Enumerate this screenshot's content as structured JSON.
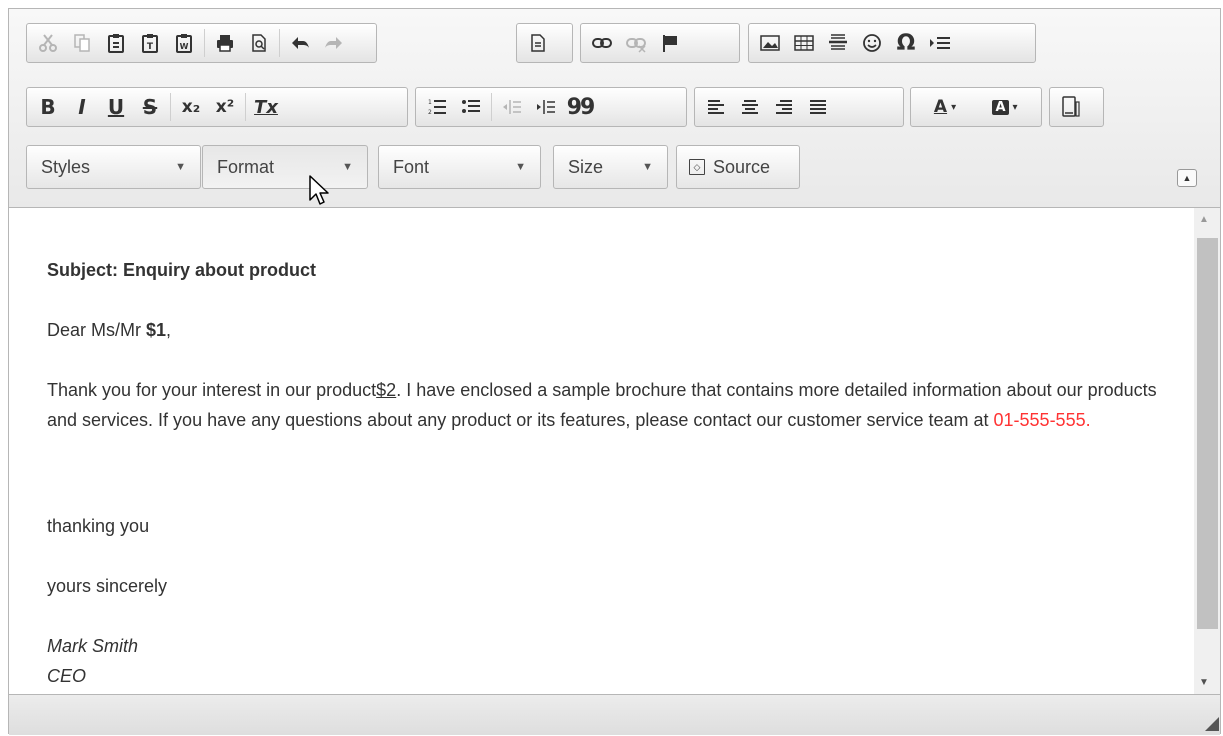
{
  "toolbar": {
    "row1": [
      "cut",
      "copy",
      "paste",
      "paste-text",
      "paste-word",
      "print",
      "preview",
      "undo",
      "redo",
      "templates",
      "link",
      "unlink",
      "anchor",
      "image",
      "table",
      "horizontal-line",
      "smiley",
      "special-char",
      "show-blocks"
    ],
    "omega": "Ω",
    "bold": "B",
    "italic": "I",
    "underline": "U",
    "strike": "S",
    "subscript": "x₂",
    "superscript": "x²",
    "remove_format": "Tx",
    "blockquote": "99",
    "text_color": "A",
    "bg_color": "A",
    "styles_label": "Styles",
    "format_label": "Format",
    "font_label": "Font",
    "size_label": "Size",
    "source_label": "Source"
  },
  "content": {
    "subject": "Subject: Enquiry about product",
    "dear_prefix": "Dear Ms/Mr ",
    "dear_var": "$1",
    "dear_suffix": ",",
    "para_a": "Thank you for your interest in our product",
    "para_var": "$2",
    "para_b": ". I have enclosed a sample brochure that contains more detailed information about our products and services. If you have any questions about any product or its features, please contact our customer service team at ",
    "phone": "01-555-555",
    "para_end": ".",
    "thanks": "thanking you",
    "yours": "yours sincerely",
    "sign_name": "Mark Smith",
    "sign_title": "CEO"
  },
  "colors": {
    "phone": "#ff3333",
    "toolbar_bg": "#efefef",
    "border": "#b6b6b6"
  }
}
